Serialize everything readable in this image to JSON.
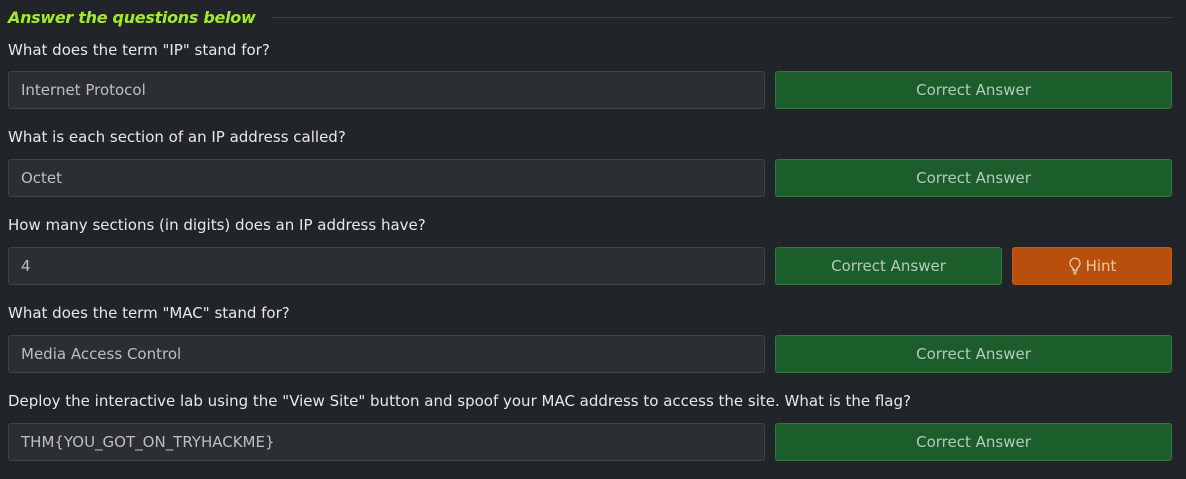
{
  "header": {
    "title": "Answer the questions below"
  },
  "questions": [
    {
      "text": "What does the term \"IP\" stand for?",
      "answer": "Internet Protocol",
      "button_label": "Correct Answer"
    },
    {
      "text": "What is each section of an IP address called?",
      "answer": "Octet",
      "button_label": "Correct Answer"
    },
    {
      "text": "How many sections (in digits) does an IP address have?",
      "answer": "4",
      "button_label": "Correct Answer",
      "hint_label": "Hint"
    },
    {
      "text": "What does the term \"MAC\" stand for?",
      "answer": "Media Access Control",
      "button_label": "Correct Answer"
    },
    {
      "text": "Deploy the interactive lab using the \"View Site\" button and spoof your MAC address to access the site.  What is the flag?",
      "answer": "THM{YOU_GOT_ON_TRYHACKME}",
      "button_label": "Correct Answer"
    }
  ],
  "colors": {
    "accent_green_text": "#a3ea2a",
    "correct_button": "#1c5e2b",
    "hint_button": "#b84f0c",
    "background": "#212428"
  },
  "icons": {
    "hint": "lightbulb-icon"
  }
}
